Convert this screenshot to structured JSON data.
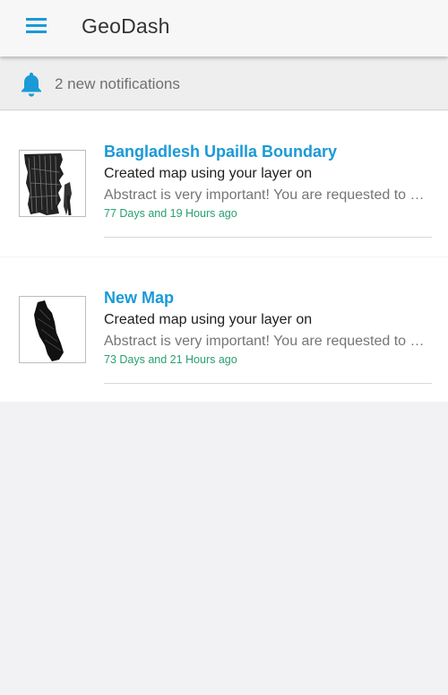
{
  "app": {
    "title": "GeoDash",
    "menu_icon": "hamburger-menu-icon",
    "accent_color": "#1a9ad6"
  },
  "notifications_bar": {
    "icon": "bell-icon",
    "text": "2 new notifications"
  },
  "notifications": [
    {
      "title": "Bangladlesh Upailla Boundary",
      "subtitle": "Created map using your layer on",
      "abstract": "Abstract is very important! You are requested to write a proper abstract",
      "time": "77 Days and 19 Hours ago",
      "thumbnail": "map-thumbnail"
    },
    {
      "title": "New Map",
      "subtitle": "Created map using your layer on",
      "abstract": "Abstract is very important! You are requested to write a proper abstract",
      "time": "73 Days and 21 Hours ago",
      "thumbnail": "map-thumbnail"
    }
  ]
}
